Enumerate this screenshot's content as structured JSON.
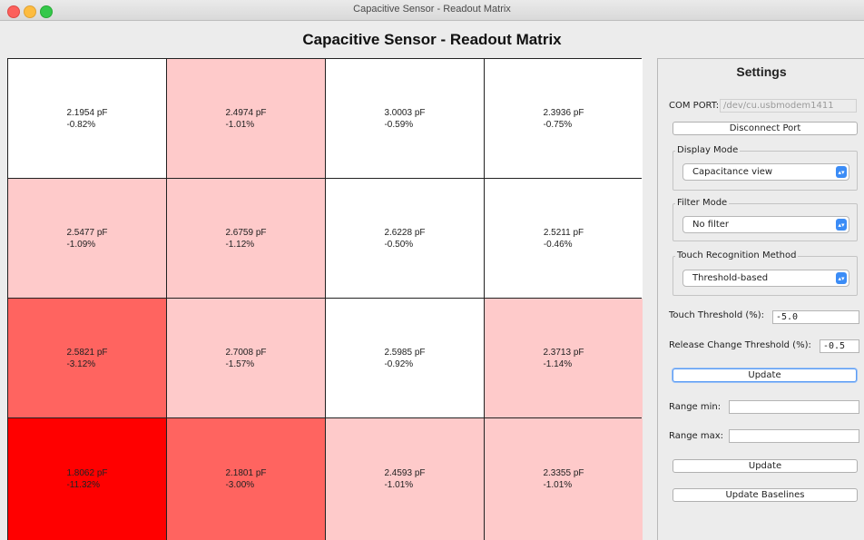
{
  "window": {
    "title": "Capacitive Sensor - Readout Matrix"
  },
  "heading": "Capacitive Sensor - Readout Matrix",
  "matrix": {
    "rows": [
      [
        {
          "capacitance": "2.1954 pF",
          "change": "-0.82%",
          "color": "#ffffff"
        },
        {
          "capacitance": "2.4974 pF",
          "change": "-1.01%",
          "color": "#fecaca"
        },
        {
          "capacitance": "3.0003 pF",
          "change": "-0.59%",
          "color": "#ffffff"
        },
        {
          "capacitance": "2.3936 pF",
          "change": "-0.75%",
          "color": "#ffffff"
        }
      ],
      [
        {
          "capacitance": "2.5477 pF",
          "change": "-1.09%",
          "color": "#fecaca"
        },
        {
          "capacitance": "2.6759 pF",
          "change": "-1.12%",
          "color": "#fecaca"
        },
        {
          "capacitance": "2.6228 pF",
          "change": "-0.50%",
          "color": "#ffffff"
        },
        {
          "capacitance": "2.5211 pF",
          "change": "-0.46%",
          "color": "#ffffff"
        }
      ],
      [
        {
          "capacitance": "2.5821 pF",
          "change": "-3.12%",
          "color": "#ff6460"
        },
        {
          "capacitance": "2.7008 pF",
          "change": "-1.57%",
          "color": "#fecaca"
        },
        {
          "capacitance": "2.5985 pF",
          "change": "-0.92%",
          "color": "#ffffff"
        },
        {
          "capacitance": "2.3713 pF",
          "change": "-1.14%",
          "color": "#fecaca"
        }
      ],
      [
        {
          "capacitance": "1.8062 pF",
          "change": "-11.32%",
          "color": "#ff0000"
        },
        {
          "capacitance": "2.1801 pF",
          "change": "-3.00%",
          "color": "#ff6460"
        },
        {
          "capacitance": "2.4593 pF",
          "change": "-1.01%",
          "color": "#fecaca"
        },
        {
          "capacitance": "2.3355 pF",
          "change": "-1.01%",
          "color": "#fecaca"
        }
      ]
    ]
  },
  "settings": {
    "title": "Settings",
    "com_port_label": "COM PORT:",
    "com_port_value": "/dev/cu.usbmodem1411",
    "disconnect_label": "Disconnect Port",
    "display_mode": {
      "title": "Display Mode",
      "selected": "Capacitance view"
    },
    "filter_mode": {
      "title": "Filter Mode",
      "selected": "No filter"
    },
    "touch_method": {
      "title": "Touch Recognition Method",
      "selected": "Threshold-based"
    },
    "touch_threshold_label": "Touch Threshold (%):",
    "touch_threshold_value": "-5.0",
    "release_threshold_label": "Release Change Threshold (%):",
    "release_threshold_value": "-0.5",
    "update_label_1": "Update",
    "range_min_label": "Range min:",
    "range_min_value": "",
    "range_max_label": "Range max:",
    "range_max_value": "",
    "update_label_2": "Update",
    "update_baselines_label": "Update Baselines"
  },
  "accent_color": "#3b8cf6"
}
